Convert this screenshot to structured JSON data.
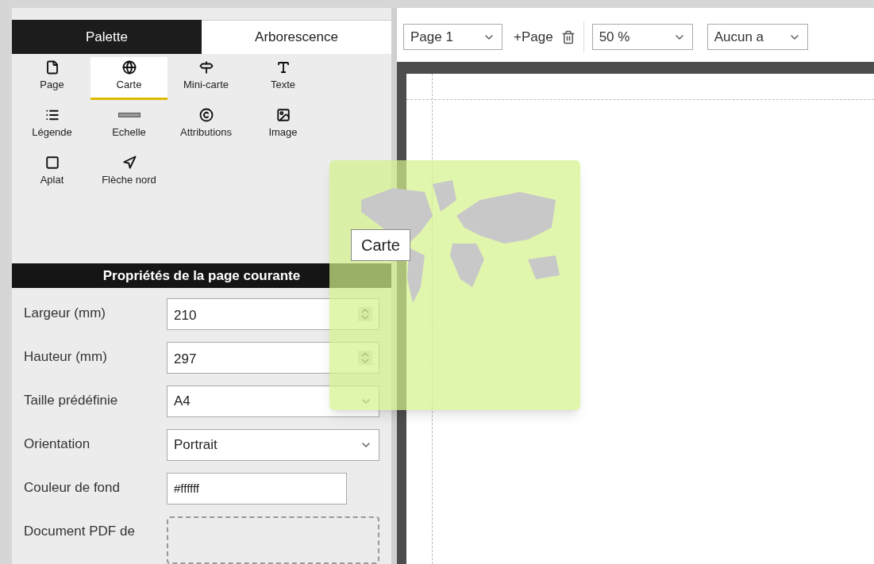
{
  "tabs": [
    {
      "label": "Palette",
      "selected": true
    },
    {
      "label": "Arborescence",
      "selected": false
    }
  ],
  "palette": [
    {
      "label": "Page",
      "kind": "page",
      "selected": false
    },
    {
      "label": "Carte",
      "kind": "globe",
      "selected": true
    },
    {
      "label": "Mini-carte",
      "kind": "signpost",
      "selected": false
    },
    {
      "label": "Texte",
      "kind": "text",
      "selected": false
    },
    {
      "label": "Légende",
      "kind": "list",
      "selected": false
    },
    {
      "label": "Echelle",
      "kind": "scale",
      "selected": false
    },
    {
      "label": "Attributions",
      "kind": "copyright",
      "selected": false
    },
    {
      "label": "Image",
      "kind": "image",
      "selected": false
    },
    {
      "label": "Aplat",
      "kind": "square",
      "selected": false
    },
    {
      "label": "Flèche nord",
      "kind": "arrow",
      "selected": false
    }
  ],
  "properties": {
    "title": "Propriétés de la page courante",
    "fields": [
      {
        "label": "Largeur (mm)",
        "kind": "spinner",
        "value": "210"
      },
      {
        "label": "Hauteur (mm)",
        "kind": "spinner",
        "value": "297"
      },
      {
        "label": "Taille prédéfinie",
        "kind": "select",
        "value": "A4"
      },
      {
        "label": "Orientation",
        "kind": "select",
        "value": "Portrait"
      },
      {
        "label": "Couleur de fond",
        "kind": "color",
        "value": "#ffffff"
      },
      {
        "label": "Document PDF de",
        "kind": "drop"
      }
    ]
  },
  "toolbar": {
    "page_select": "Page 1",
    "add_page": "+Page",
    "zoom_select": "50 %",
    "snap_select": "Aucun a"
  },
  "drag_preview": {
    "label": "Carte"
  }
}
